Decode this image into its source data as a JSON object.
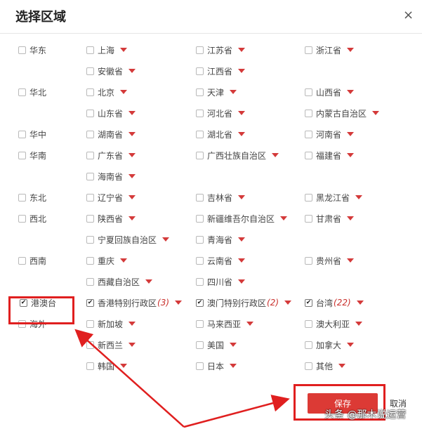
{
  "dialog": {
    "title": "选择区域",
    "close_label": "×"
  },
  "groups": [
    {
      "region": "华东",
      "checked": false,
      "provinces": [
        {
          "name": "上海",
          "checked": false
        },
        {
          "name": "江苏省",
          "checked": false
        },
        {
          "name": "浙江省",
          "checked": false
        },
        {
          "name": "安徽省",
          "checked": false
        },
        {
          "name": "江西省",
          "checked": false
        }
      ]
    },
    {
      "region": "华北",
      "checked": false,
      "provinces": [
        {
          "name": "北京",
          "checked": false
        },
        {
          "name": "天津",
          "checked": false
        },
        {
          "name": "山西省",
          "checked": false
        },
        {
          "name": "山东省",
          "checked": false
        },
        {
          "name": "河北省",
          "checked": false
        },
        {
          "name": "内蒙古自治区",
          "checked": false
        }
      ]
    },
    {
      "region": "华中",
      "checked": false,
      "provinces": [
        {
          "name": "湖南省",
          "checked": false
        },
        {
          "name": "湖北省",
          "checked": false
        },
        {
          "name": "河南省",
          "checked": false
        }
      ]
    },
    {
      "region": "华南",
      "checked": false,
      "provinces": [
        {
          "name": "广东省",
          "checked": false
        },
        {
          "name": "广西壮族自治区",
          "checked": false
        },
        {
          "name": "福建省",
          "checked": false
        },
        {
          "name": "海南省",
          "checked": false
        }
      ]
    },
    {
      "region": "东北",
      "checked": false,
      "provinces": [
        {
          "name": "辽宁省",
          "checked": false
        },
        {
          "name": "吉林省",
          "checked": false
        },
        {
          "name": "黑龙江省",
          "checked": false
        }
      ]
    },
    {
      "region": "西北",
      "checked": false,
      "provinces": [
        {
          "name": "陕西省",
          "checked": false
        },
        {
          "name": "新疆维吾尔自治区",
          "checked": false
        },
        {
          "name": "甘肃省",
          "checked": false
        },
        {
          "name": "宁夏回族自治区",
          "checked": false
        },
        {
          "name": "青海省",
          "checked": false
        }
      ]
    },
    {
      "region": "西南",
      "checked": false,
      "provinces": [
        {
          "name": "重庆",
          "checked": false
        },
        {
          "name": "云南省",
          "checked": false
        },
        {
          "name": "贵州省",
          "checked": false
        },
        {
          "name": "西藏自治区",
          "checked": false
        },
        {
          "name": "四川省",
          "checked": false
        }
      ]
    },
    {
      "region": "港澳台",
      "checked": true,
      "provinces": [
        {
          "name": "香港特别行政区",
          "checked": true,
          "count": "(3)"
        },
        {
          "name": "澳门特别行政区",
          "checked": true,
          "count": "(2)"
        },
        {
          "name": "台湾",
          "checked": true,
          "count": "(22)"
        }
      ]
    },
    {
      "region": "海外",
      "checked": false,
      "provinces": [
        {
          "name": "新加坡",
          "checked": false
        },
        {
          "name": "马来西亚",
          "checked": false
        },
        {
          "name": "澳大利亚",
          "checked": false
        },
        {
          "name": "新西兰",
          "checked": false
        },
        {
          "name": "美国",
          "checked": false
        },
        {
          "name": "加拿大",
          "checked": false
        },
        {
          "name": "韩国",
          "checked": false
        },
        {
          "name": "日本",
          "checked": false
        },
        {
          "name": "其他",
          "checked": false
        }
      ]
    }
  ],
  "footer": {
    "save_label": "保存",
    "cancel_label": "取消"
  },
  "watermark": "头条 @那木说运营",
  "colors": {
    "accent": "#dc3a35",
    "annotation": "#e01f1f"
  }
}
